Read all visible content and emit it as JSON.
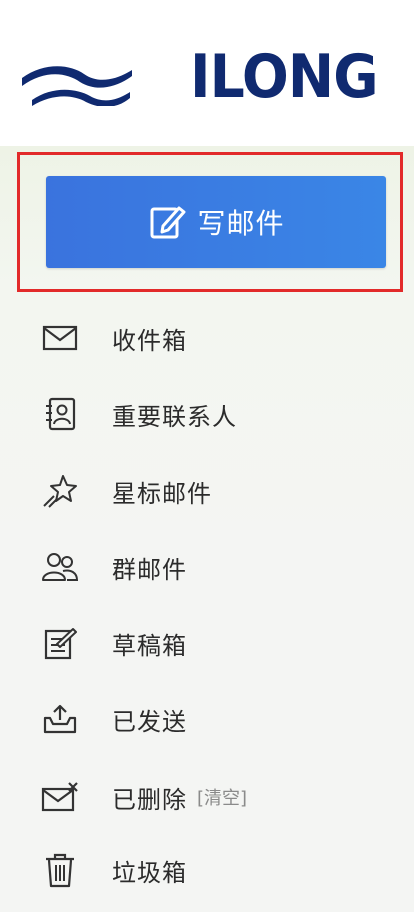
{
  "header": {
    "brand": "ILONG",
    "brand_color": "#102a70"
  },
  "compose": {
    "label": "写邮件",
    "icon": "compose-icon",
    "color": "#3a7ee2"
  },
  "highlight_color": "#e22a2a",
  "menu": {
    "items": [
      {
        "label": "收件箱",
        "icon": "envelope-icon"
      },
      {
        "label": "重要联系人",
        "icon": "contact-book-icon"
      },
      {
        "label": "星标邮件",
        "icon": "star-icon"
      },
      {
        "label": "群邮件",
        "icon": "group-icon"
      },
      {
        "label": "草稿箱",
        "icon": "draft-icon"
      },
      {
        "label": "已发送",
        "icon": "outbox-icon"
      },
      {
        "label": "已删除",
        "icon": "deleted-mail-icon",
        "clear_label": "[清空]"
      },
      {
        "label": "垃圾箱",
        "icon": "trash-icon"
      }
    ]
  }
}
